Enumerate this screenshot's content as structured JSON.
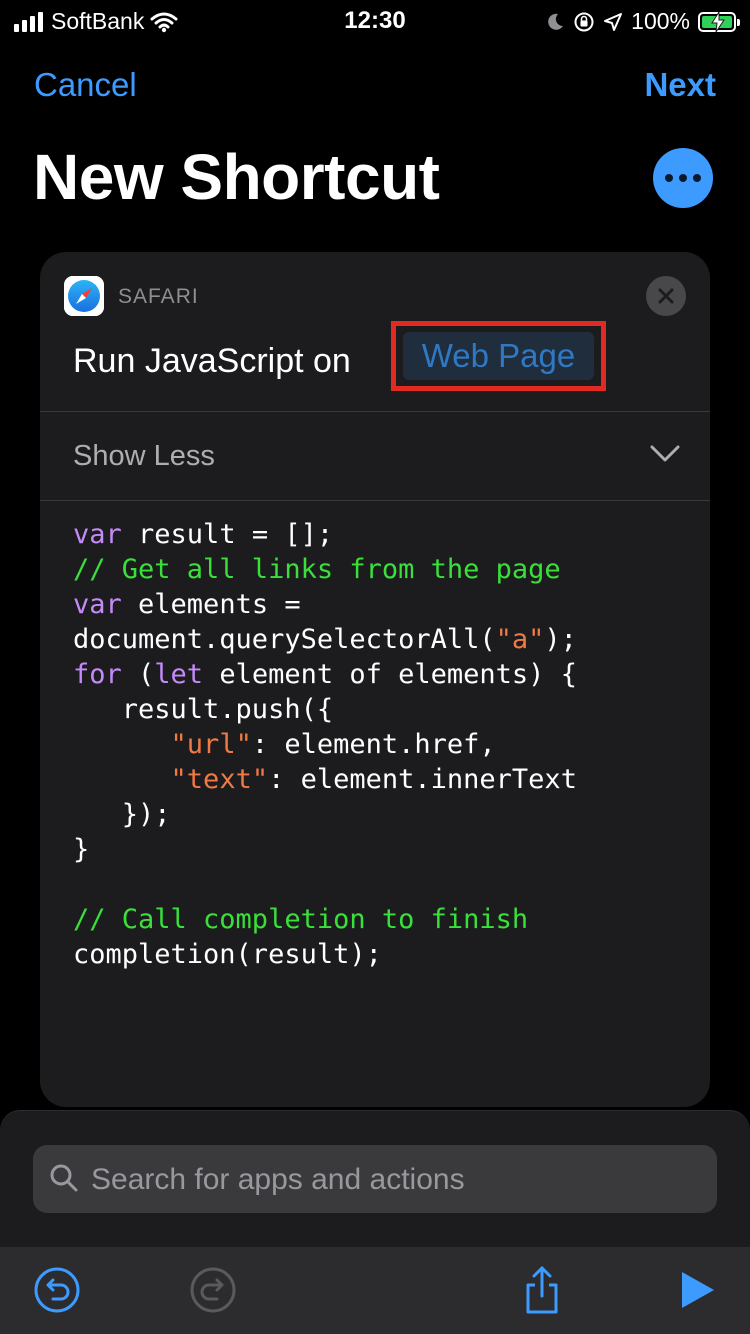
{
  "status_bar": {
    "carrier": "SoftBank",
    "time": "12:30",
    "battery": "100%"
  },
  "nav": {
    "cancel": "Cancel",
    "next": "Next"
  },
  "title": "New Shortcut",
  "action_card": {
    "app": "SAFARI",
    "action": "Run JavaScript on",
    "parameter": "Web Page",
    "toggle": "Show Less",
    "code": [
      [
        {
          "t": "var",
          "c": "kw"
        },
        {
          "t": " result = [];"
        }
      ],
      [
        {
          "t": "// Get all links from the page",
          "c": "cm"
        }
      ],
      [
        {
          "t": "var",
          "c": "kw"
        },
        {
          "t": " elements ="
        }
      ],
      [
        {
          "t": "document.querySelectorAll("
        },
        {
          "t": "\"a\"",
          "c": "str"
        },
        {
          "t": ");"
        }
      ],
      [
        {
          "t": "for",
          "c": "kw"
        },
        {
          "t": " ("
        },
        {
          "t": "let",
          "c": "kw"
        },
        {
          "t": " element of elements) {"
        }
      ],
      [
        {
          "t": "   result.push({"
        }
      ],
      [
        {
          "t": "      "
        },
        {
          "t": "\"url\"",
          "c": "str"
        },
        {
          "t": ": element.href,"
        }
      ],
      [
        {
          "t": "      "
        },
        {
          "t": "\"text\"",
          "c": "str"
        },
        {
          "t": ": element.innerText"
        }
      ],
      [
        {
          "t": "   });"
        }
      ],
      [
        {
          "t": "}"
        }
      ],
      [
        {
          "t": ""
        }
      ],
      [
        {
          "t": "// Call completion to finish",
          "c": "cm"
        }
      ],
      [
        {
          "t": "completion(result);"
        }
      ]
    ]
  },
  "search": {
    "placeholder": "Search for apps and actions"
  },
  "icons": {
    "undo": "undo-icon",
    "redo": "redo-icon",
    "share": "share-icon",
    "play": "play-icon"
  },
  "colors": {
    "accent": "#3d9bff",
    "highlight_border": "#e12a22",
    "keyword": "#c58af9",
    "comment": "#3ae03a",
    "string": "#f07a43"
  }
}
